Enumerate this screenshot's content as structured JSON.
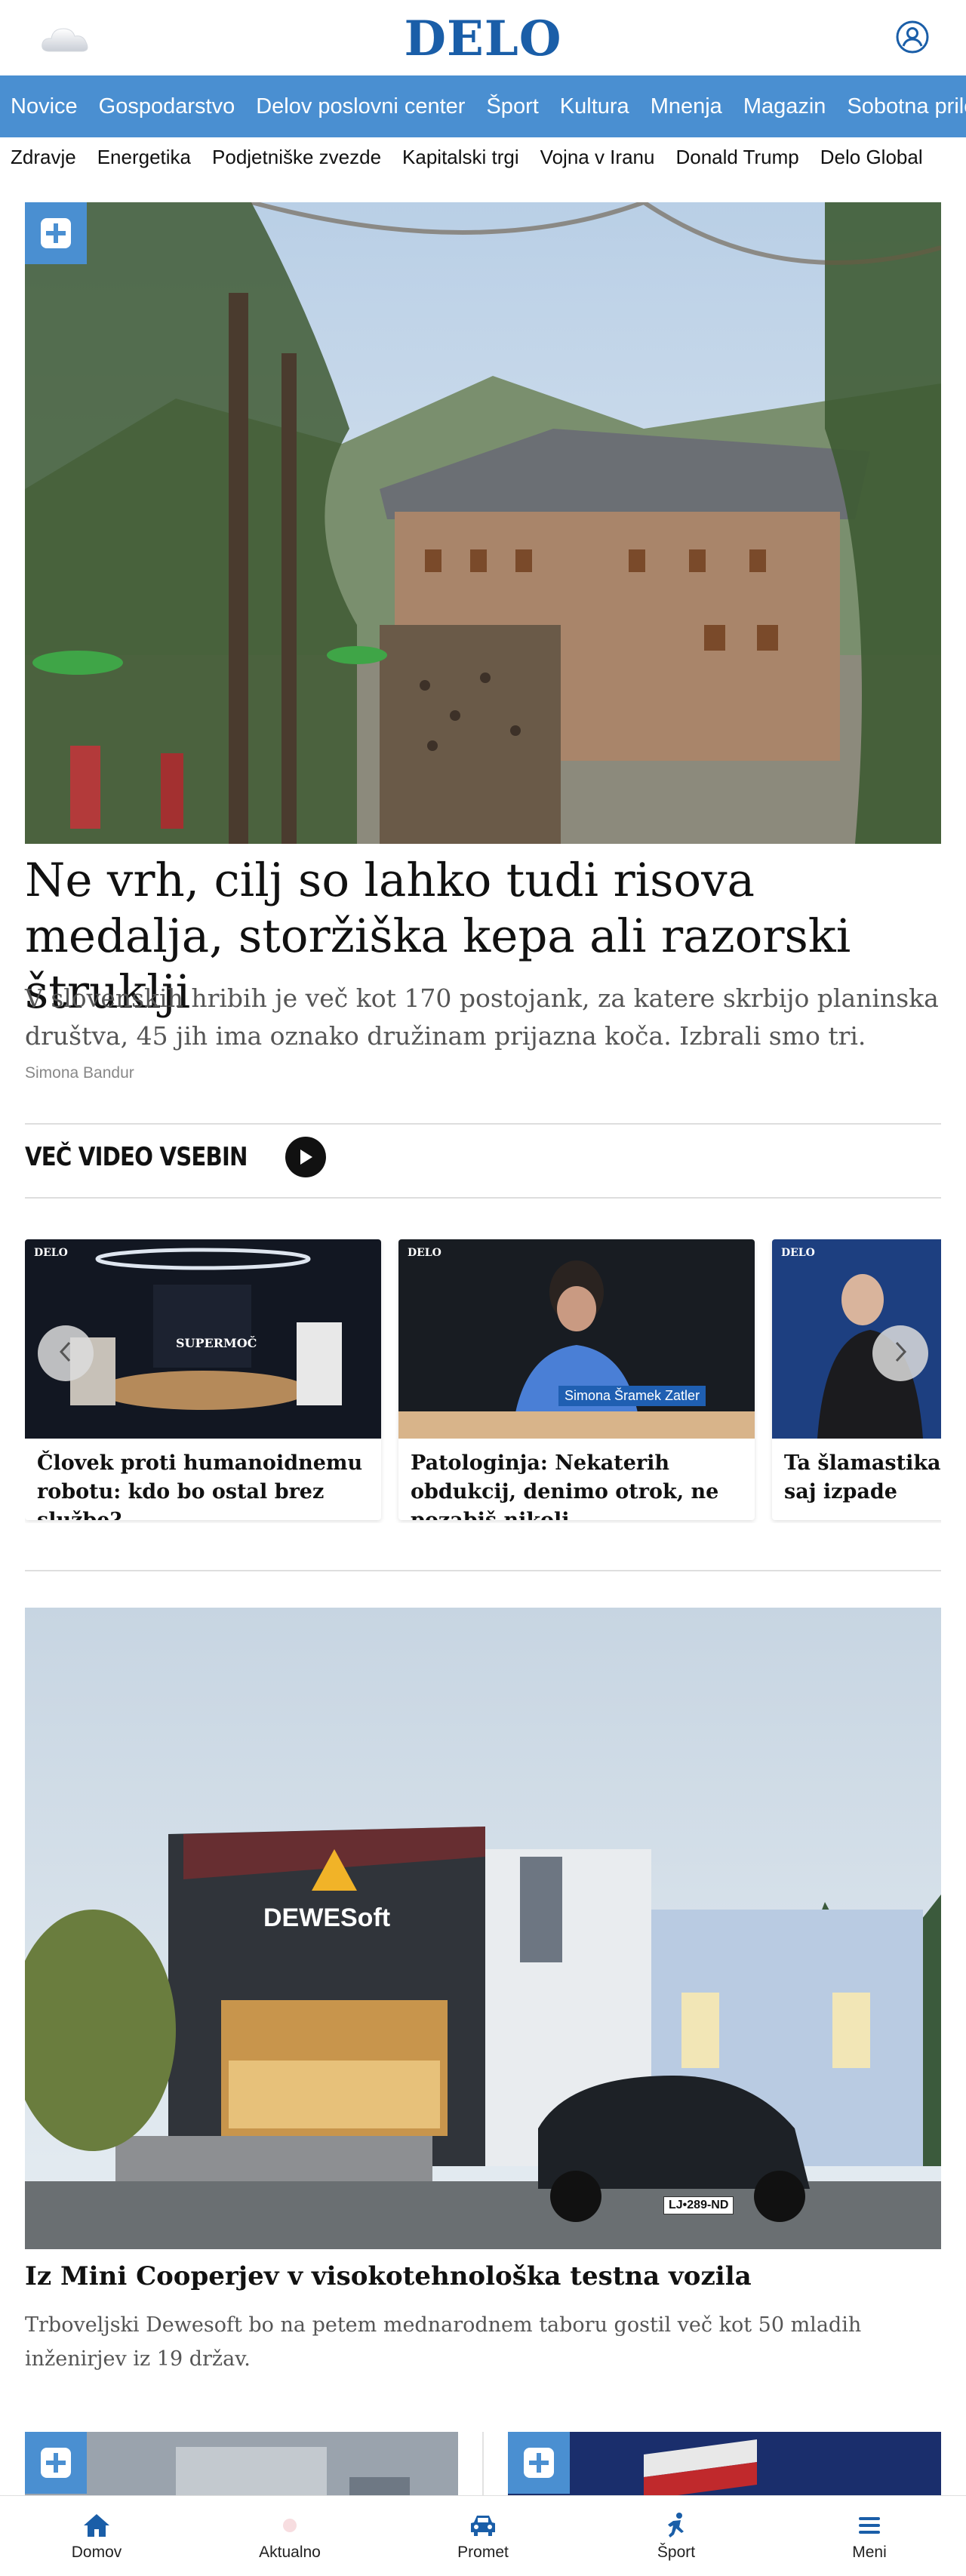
{
  "header": {
    "logo": "DELO"
  },
  "nav": {
    "items": [
      "Novice",
      "Gospodarstvo",
      "Delov poslovni center",
      "Šport",
      "Kultura",
      "Mnenja",
      "Magazin",
      "Sobotna priloga"
    ]
  },
  "subnav": {
    "items": [
      "Zdravje",
      "Energetika",
      "Podjetniške zvezde",
      "Kapitalski trgi",
      "Vojna v Iranu",
      "Donald Trump",
      "Delo Global"
    ]
  },
  "hero": {
    "title": "Ne vrh, cilj so lahko tudi risova medalja, storžiška kepa ali razorski štruklji",
    "lead": "V slovenskih hribih je več kot 170 postojank, za katere skrbijo planinska društva, 45 jih ima oznako družinam prijazna koča. Izbrali smo tri.",
    "author": "Simona Bandur"
  },
  "video": {
    "heading": "VEČ VIDEO VSEBIN",
    "cards": [
      {
        "brand": "DELO",
        "overlay": "SUPERMOČ",
        "title": "Človek proti humanoidnemu robotu: kdo bo ostal brez službe?"
      },
      {
        "brand": "DELO",
        "overlay": "Simona Šramek Zatler",
        "title": "Patologinja: Nekaterih obdukcij, denimo otrok, ne pozabiš nikoli"
      },
      {
        "brand": "DELO",
        "overlay": "",
        "title": "Ta šlamastika škodi državi, saj izpade"
      }
    ]
  },
  "article2": {
    "sign": "DEWESoft",
    "plate": "LJ•289-ND",
    "title": "Iz Mini Cooperjev v visokotehnološka testna vozila",
    "lead": "Trboveljski Dewesoft bo na petem mednarodnem taboru gostil več kot 50 mladih inženirjev iz 19 držav."
  },
  "bottom_nav": {
    "items": [
      "Domov",
      "Aktualno",
      "Promet",
      "Šport",
      "Meni"
    ]
  },
  "colors": {
    "brand": "#1a5ea8",
    "nav_bg": "#4a8fd1"
  }
}
